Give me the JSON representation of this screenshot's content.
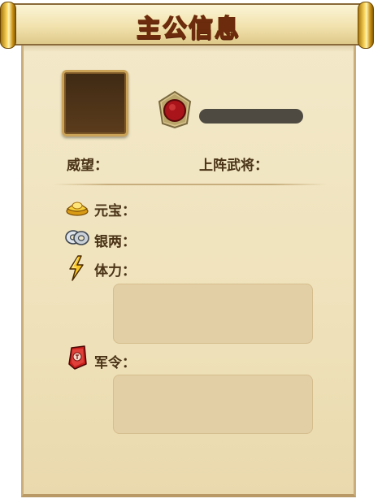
{
  "window": {
    "title": "主公信息"
  },
  "profile": {
    "prestige_label": "威望：",
    "generals_label": "上阵武将："
  },
  "resources": {
    "yuanbao_label": "元宝：",
    "silver_label": "银两：",
    "stamina_label": "体力：",
    "military_order_label": "军令："
  },
  "icons": {
    "avatar": "avatar-frame",
    "badge": "rank-badge-icon",
    "yuanbao": "gold-ingot-icon",
    "silver": "silver-coins-icon",
    "stamina": "lightning-icon",
    "military_order": "military-token-icon"
  },
  "colors": {
    "paper": "#efe2bb",
    "title_fill": "#f6c94a",
    "title_outline": "#6b2b0c",
    "label_text": "#4a3317",
    "panel": "#e3cfa5",
    "name_bar": "#4e4a42"
  }
}
